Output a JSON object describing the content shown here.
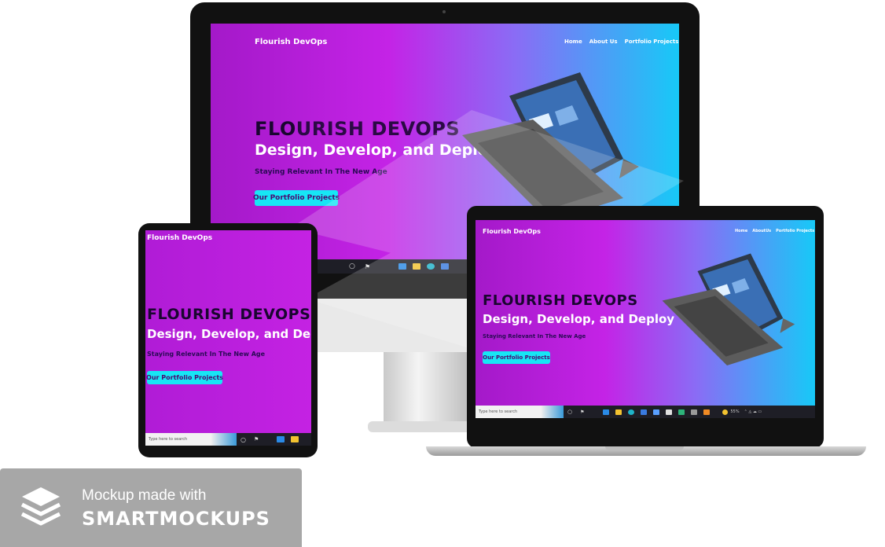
{
  "site": {
    "brand": "Flourish DevOps",
    "nav": [
      "Home",
      "About Us",
      "Portfolio Projects"
    ],
    "nav_short": [
      "Home",
      "AboutUs",
      "Portfolio Projects"
    ],
    "headline_first": "FLO",
    "headline_rest": "URISH DEVOPS",
    "headline_full": "FLOURISH DEVOPS",
    "subheadline": "Design, Develop, and Deploy",
    "tagline": "Staying Relevant In The New Age",
    "cta": "Our Portfolio Projects"
  },
  "taskbar": {
    "search_placeholder": "Type here to search",
    "tablet_search_placeholder": "Type here to search",
    "tray_percent": "55%"
  },
  "watermark": {
    "line1": "Mockup made with",
    "line2": "SMARTMOCKUPS"
  },
  "colors": {
    "accent_cyan": "#17e6f5",
    "magenta": "#c423e6",
    "purple": "#a419c9"
  }
}
